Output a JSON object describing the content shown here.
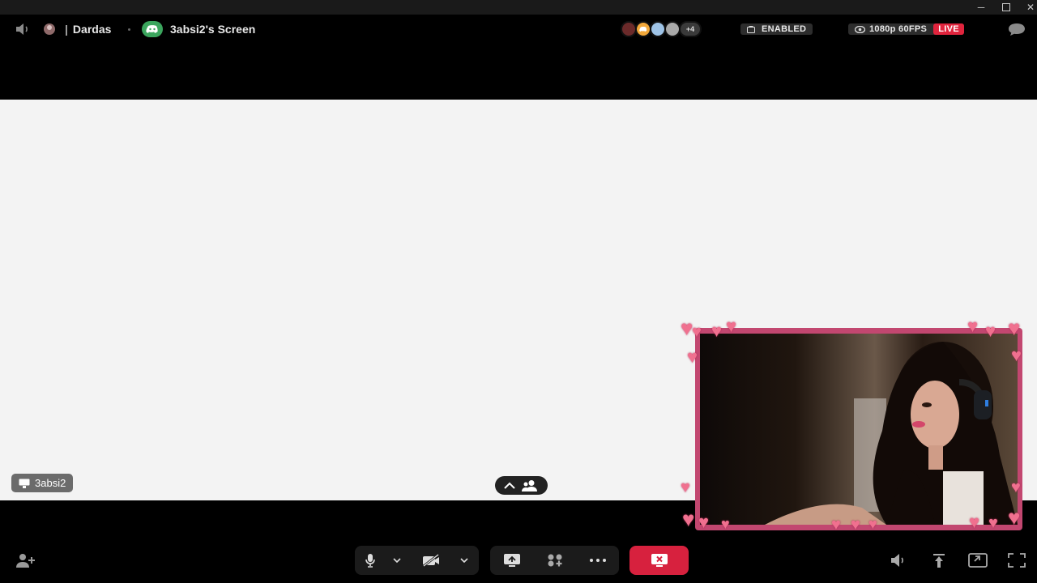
{
  "header": {
    "channel_name": "Dardas",
    "screen_title": "3absi2's Screen",
    "extra_viewers": "+4",
    "enabled_label": "ENABLED",
    "quality_label": "1080p 60FPS",
    "live_label": "LIVE"
  },
  "stage": {
    "streamer_tag": "3absi2"
  },
  "colors": {
    "live": "#e0243d",
    "end_call": "#d7213e",
    "discord_green": "#3ba55d",
    "frame_pink": "#c24770"
  },
  "icons": {
    "volume": "speaker-icon",
    "server": "server-avatar-icon",
    "discord": "discord-icon",
    "screen": "screen-icon",
    "settings_chat": "chat-bubble-icon"
  }
}
